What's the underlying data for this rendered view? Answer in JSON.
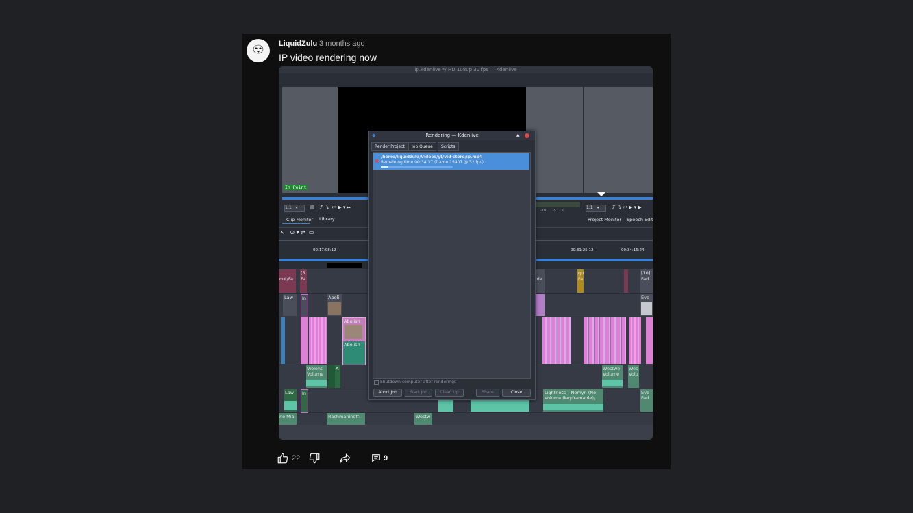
{
  "post": {
    "author": "LiquidZulu",
    "time_ago": "3 months ago",
    "text": "IP video rendering now",
    "likes": "22",
    "comments": "9"
  },
  "screenshot": {
    "window_title": "ip.kdenlive */ HD 1080p 30 fps — Kdenlive",
    "in_point": "In Point",
    "clip_monitor_tab": "Clip Monitor",
    "library_tab": "Library",
    "project_monitor_tab": "Project Monitor",
    "speech_editor_tab": "Speech Editor",
    "zoom_left": "1:1",
    "zoom_right": "1:1",
    "timecodes": [
      "00:17:08:12",
      "00:31:25:12",
      "00:34:16:24"
    ],
    "audio_scale": [
      "-10",
      "-5",
      "0"
    ],
    "dialog": {
      "title": "Rendering — Kdenlive",
      "tabs": [
        "Render Project",
        "Job Queue",
        "Scripts"
      ],
      "job_path": "/home/liquidzulu/Videos/yt/vid-store/ip.mp4",
      "job_status": "Remaining time 00:34:37 (frame 15407 @ 32 fps)",
      "job_progress": 0.1,
      "shutdown_label": "Shutdown computer after renderings",
      "buttons": [
        "Abort Job",
        "Start Job",
        "Clean Up",
        "Share",
        "Close"
      ]
    },
    "clips": {
      "c1": "out/Fa",
      "c2": "[5",
      "c3": "Fa",
      "c4": "Law",
      "c5": "In",
      "c6": "Aboli",
      "c7": "Abolish",
      "c8": "Abolish",
      "c9": "Violent",
      "c10": "Volume",
      "c11": "A",
      "c12": "Law",
      "c13": "In",
      "c14": "ne Mia",
      "c15": "Rachmaninoff:",
      "c16": "Westw",
      "c17": "qu",
      "c18": "Fa",
      "c19": "[10]",
      "c20": "Fad",
      "c21": "Eve",
      "c22": "Westwo",
      "c23": "Volume",
      "c24": "Wes",
      "c25": "Volu",
      "c26": "Lightness – Nomyn (No",
      "c27": "Volume (keyframable)/",
      "c28": "Eve",
      "c29": "Fad",
      "c30": "cde"
    }
  }
}
